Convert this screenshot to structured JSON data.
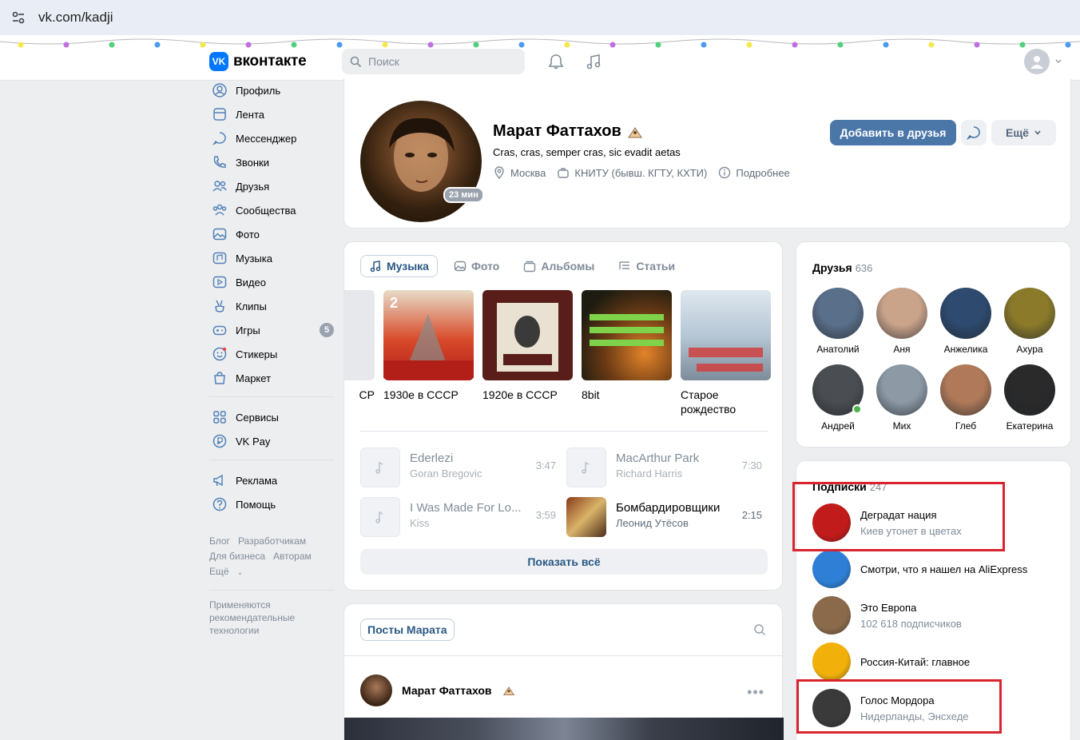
{
  "browser": {
    "url": "vk.com/kadji"
  },
  "header": {
    "logo_text": "вконтакте",
    "search_placeholder": "Поиск"
  },
  "nav": {
    "items": [
      {
        "label": "Профиль",
        "icon": "profile-icon"
      },
      {
        "label": "Лента",
        "icon": "news-icon"
      },
      {
        "label": "Мессенджер",
        "icon": "messenger-icon"
      },
      {
        "label": "Звонки",
        "icon": "phone-icon"
      },
      {
        "label": "Друзья",
        "icon": "friends-icon"
      },
      {
        "label": "Сообщества",
        "icon": "communities-icon"
      },
      {
        "label": "Фото",
        "icon": "photo-icon"
      },
      {
        "label": "Музыка",
        "icon": "music-icon"
      },
      {
        "label": "Видео",
        "icon": "video-icon"
      },
      {
        "label": "Клипы",
        "icon": "clips-icon"
      },
      {
        "label": "Игры",
        "icon": "games-icon",
        "badge": "5"
      },
      {
        "label": "Стикеры",
        "icon": "stickers-icon"
      },
      {
        "label": "Маркет",
        "icon": "market-icon"
      }
    ],
    "items2": [
      {
        "label": "Сервисы",
        "icon": "services-icon"
      },
      {
        "label": "VK Pay",
        "icon": "vkpay-icon"
      }
    ],
    "items3": [
      {
        "label": "Реклама",
        "icon": "ads-icon"
      },
      {
        "label": "Помощь",
        "icon": "help-icon"
      }
    ],
    "footer": [
      "Блог",
      "Разработчикам",
      "Для бизнеса",
      "Авторам",
      "Ещё"
    ],
    "rec_tech": "Применяются рекомендательные технологии"
  },
  "profile": {
    "name": "Марат Фаттахов",
    "status": "Cras, cras, semper cras, sic evadit aetas",
    "online": "23 мин",
    "city": "Москва",
    "university": "КНИТУ (бывш. КГТУ, КХТИ)",
    "details": "Подробнее",
    "add_friend": "Добавить в друзья",
    "more": "Ещё"
  },
  "media": {
    "tabs": [
      "Музыка",
      "Фото",
      "Альбомы",
      "Статьи"
    ],
    "albums": [
      {
        "title": "СР",
        "color": "#e6e8ec"
      },
      {
        "title": "1930е в СССР",
        "color": "#c8291f"
      },
      {
        "title": "1920е в СССР",
        "color": "#5a1e1a"
      },
      {
        "title": "8bit",
        "color": "#2c2d1f"
      },
      {
        "title": "Старое рождество",
        "color": "#b6c7d6"
      }
    ],
    "tracks": [
      {
        "title": "Ederlezi",
        "artist": "Goran Bregovic",
        "duration": "3:47"
      },
      {
        "title": "MacArthur Park",
        "artist": "Richard Harris",
        "duration": "7:30"
      },
      {
        "title": "I Was Made For Lo...",
        "artist": "Kiss",
        "duration": "3:59"
      },
      {
        "title": "Бомбардировщики",
        "artist": "Леонид Утёсов",
        "duration": "2:15"
      }
    ],
    "show_all": "Показать всё"
  },
  "posts": {
    "tab": "Посты Марата",
    "author": "Марат Фаттахов"
  },
  "friends": {
    "title": "Друзья",
    "count": "636",
    "list": [
      {
        "name": "Анатолий",
        "color": "#5a6f8a"
      },
      {
        "name": "Аня",
        "color": "#c9a38a"
      },
      {
        "name": "Анжелика",
        "color": "#2e4a6e"
      },
      {
        "name": "Ахура",
        "color": "#8a7a2a"
      },
      {
        "name": "Андрей",
        "color": "#4a4d52",
        "online": true
      },
      {
        "name": "Мих",
        "color": "#8d9aa6"
      },
      {
        "name": "Глеб",
        "color": "#b07a5a"
      },
      {
        "name": "Екатерина",
        "color": "#2a2a2a"
      }
    ]
  },
  "subscriptions": {
    "title": "Подписки",
    "count": "247",
    "list": [
      {
        "name": "Деградат нация",
        "sub": "Киев утонет в цветах",
        "color": "#c21b1b"
      },
      {
        "name": "Смотри, что я нашел на AliExpress",
        "sub": "",
        "color": "#2f7fd6"
      },
      {
        "name": "Это Европа",
        "sub": "102 618 подписчиков",
        "color": "#8a6a4a"
      },
      {
        "name": "Россия-Китай: главное",
        "sub": "",
        "color": "#f2b10a"
      },
      {
        "name": "Голос Мордора",
        "sub": "Нидерланды, Энсхеде",
        "color": "#3a3a3a"
      }
    ]
  },
  "colors": {
    "accent": "#4a76a8",
    "highlight_box": "#d9242e"
  }
}
